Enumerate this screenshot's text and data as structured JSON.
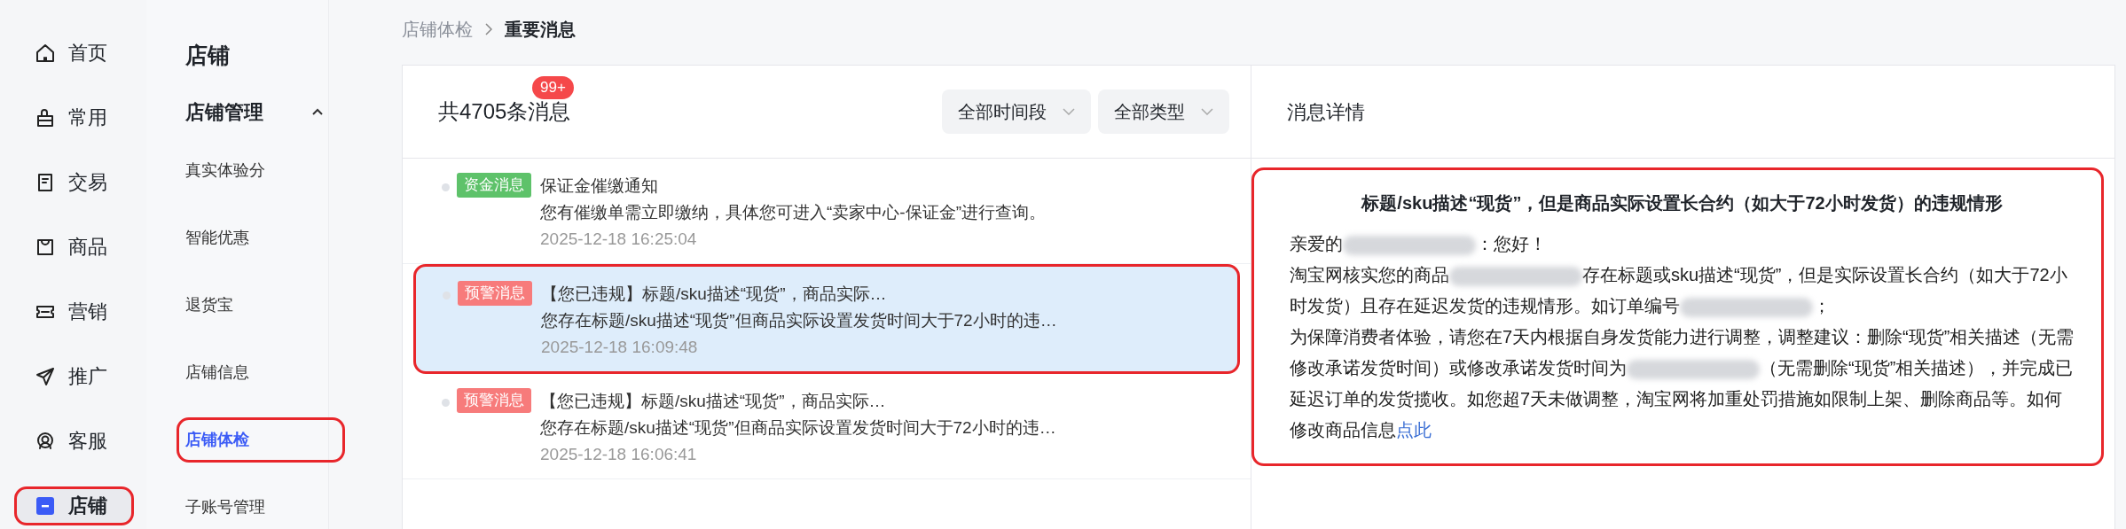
{
  "primary_nav": [
    {
      "label": "首页",
      "selected": false,
      "highlighted": false
    },
    {
      "label": "常用",
      "selected": false,
      "highlighted": false
    },
    {
      "label": "交易",
      "selected": false,
      "highlighted": false
    },
    {
      "label": "商品",
      "selected": false,
      "highlighted": false
    },
    {
      "label": "营销",
      "selected": false,
      "highlighted": false
    },
    {
      "label": "推广",
      "selected": false,
      "highlighted": false
    },
    {
      "label": "客服",
      "selected": false,
      "highlighted": false
    },
    {
      "label": "店铺",
      "selected": true,
      "highlighted": true
    }
  ],
  "secondary_nav": {
    "title": "店铺",
    "group": {
      "label": "店铺管理",
      "expanded": true,
      "items": [
        {
          "label": "真实体验分",
          "selected": false,
          "highlighted": false
        },
        {
          "label": "智能优惠",
          "selected": false,
          "highlighted": false
        },
        {
          "label": "退货宝",
          "selected": false,
          "highlighted": false
        },
        {
          "label": "店铺信息",
          "selected": false,
          "highlighted": false
        },
        {
          "label": "店铺体检",
          "selected": true,
          "highlighted": true
        },
        {
          "label": "子账号管理",
          "selected": false,
          "highlighted": false
        }
      ]
    }
  },
  "breadcrumb": [
    "店铺体检",
    "重要消息"
  ],
  "message_list": {
    "count_label": "共4705条消息",
    "unread_badge": "99+",
    "filters": [
      "全部时间段",
      "全部类型"
    ],
    "messages": [
      {
        "tag": "资金消息",
        "color": "#5ec26a",
        "title": "保证金催缴通知",
        "summary": "您有催缴单需立即缴纳，具体您可进入“卖家中心-保证金”进行查询。",
        "time": "2025-12-18 16:25:04",
        "selected": false,
        "highlighted": false
      },
      {
        "tag": "预警消息",
        "color": "#f77b7b",
        "title": "【您已违规】标题/sku描述“现货”，商品实际…",
        "summary": "您存在标题/sku描述“现货”但商品实际设置发货时间大于72小时的违…",
        "time": "2025-12-18 16:09:48",
        "selected": true,
        "highlighted": true
      },
      {
        "tag": "预警消息",
        "color": "#f77b7b",
        "title": "【您已违规】标题/sku描述“现货”，商品实际…",
        "summary": "您存在标题/sku描述“现货”但商品实际设置发货时间大于72小时的违…",
        "time": "2025-12-18 16:06:41",
        "selected": false,
        "highlighted": false
      }
    ]
  },
  "detail": {
    "header": "消息详情",
    "highlighted": true,
    "title": "标题/sku描述“现货”，但是商品实际设置长合约（如大于72小时发货）的违规情形",
    "paragraphs": [
      [
        {
          "kind": "text",
          "text": "亲爱的"
        },
        {
          "kind": "redacted"
        },
        {
          "kind": "text",
          "text": "：您好！"
        }
      ],
      [
        {
          "kind": "text",
          "text": "淘宝网核实您的商品"
        },
        {
          "kind": "redacted"
        },
        {
          "kind": "text",
          "text": "存在标题或sku描述“现货”，但是实际设置长合约（如大于72小时发货）且存在延迟发货的违规情形。如订单编号"
        },
        {
          "kind": "redacted"
        },
        {
          "kind": "text",
          "text": "；"
        }
      ],
      [
        {
          "kind": "text",
          "text": "为保障消费者体验，请您在7天内根据自身发货能力进行调整，调整建议：删除“现货”相关描述（无需修改承诺发货时间）或修改承诺发货时间为"
        },
        {
          "kind": "redacted"
        },
        {
          "kind": "text",
          "text": "（无需删除“现货”相关描述），并完成已延迟订单的发货揽收。如您超7天未做调整，淘宝网将加重处罚措施如限制上架、删除商品等。如何修改商品信息"
        },
        {
          "kind": "link",
          "text": "点此"
        }
      ]
    ]
  }
}
